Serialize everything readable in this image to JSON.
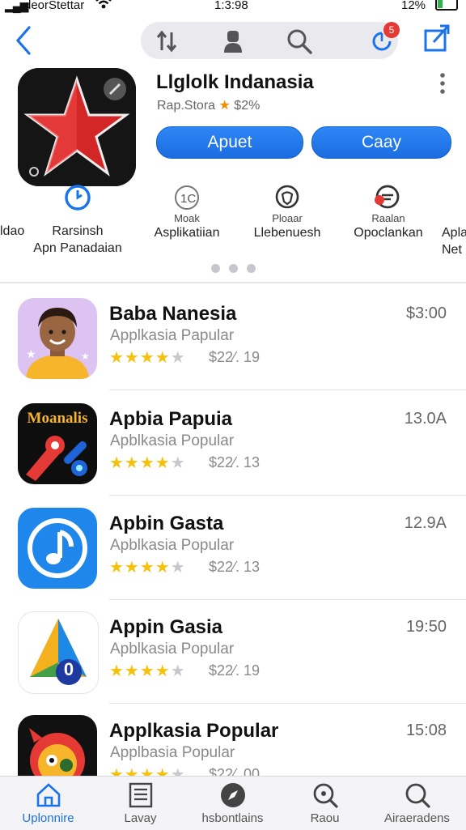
{
  "status": {
    "carrier": "deorStettar",
    "time": "1:3:98",
    "battery": "12%"
  },
  "nav": {
    "badge_count": "5"
  },
  "app": {
    "title": "Llglolk Indanasia",
    "store_label": "Rap.Stora",
    "rating_badge": "$2%",
    "primary_button": "Apuet",
    "secondary_button": "Caay"
  },
  "quick_actions": [
    {
      "small": "",
      "label_lines": [
        "Rarsinsh",
        "Apn Panadaian"
      ],
      "icon": "refresh-icon"
    },
    {
      "small": "Moak",
      "label_lines": [
        "Asplikatiian"
      ],
      "icon": "cc-icon"
    },
    {
      "small": "Ploaar",
      "label_lines": [
        "Llebenuesh"
      ],
      "icon": "shield-icon"
    },
    {
      "small": "Raalan",
      "label_lines": [
        "Opoclankan"
      ],
      "icon": "chat-icon"
    }
  ],
  "left_clip": "ldao",
  "right_clip_lines": [
    "Apla",
    "Net"
  ],
  "apps": [
    {
      "title": "Baba Nanesia",
      "subtitle": "Applkasia Papular",
      "stars": 4,
      "meta": "$22⁄. 19",
      "price": "$3:00"
    },
    {
      "title": "Apbia Papuia",
      "subtitle": "Apblkasia Popular",
      "stars": 4,
      "meta": "$22⁄. 13",
      "price": "13.0A"
    },
    {
      "title": "Apbin Gasta",
      "subtitle": "Apblkasia Popular",
      "stars": 4,
      "meta": "$22⁄. 13",
      "price": "12.9A"
    },
    {
      "title": "Appin Gasia",
      "subtitle": "Apblkasia Popular",
      "stars": 4,
      "meta": "$22⁄. 19",
      "price": "19:50"
    },
    {
      "title": "Applkasia Popular",
      "subtitle": "Applbasia Popular",
      "stars": 4,
      "meta": "$22⁄. 00",
      "price": "15:08"
    }
  ],
  "icon_text": {
    "app2": "Moanalis",
    "app4": "0"
  },
  "tabs": [
    {
      "label": "Uplonnire",
      "icon": "home-icon",
      "active": true
    },
    {
      "label": "Lavay",
      "icon": "list-icon",
      "active": false
    },
    {
      "label": "hsbontlains",
      "icon": "compass-icon",
      "active": false
    },
    {
      "label": "Raou",
      "icon": "search-icon",
      "active": false
    },
    {
      "label": "Airaeradens",
      "icon": "search-icon",
      "active": false
    }
  ],
  "colors": {
    "accent": "#1a73e8",
    "star": "#f4c20d",
    "badge": "#e53935"
  }
}
